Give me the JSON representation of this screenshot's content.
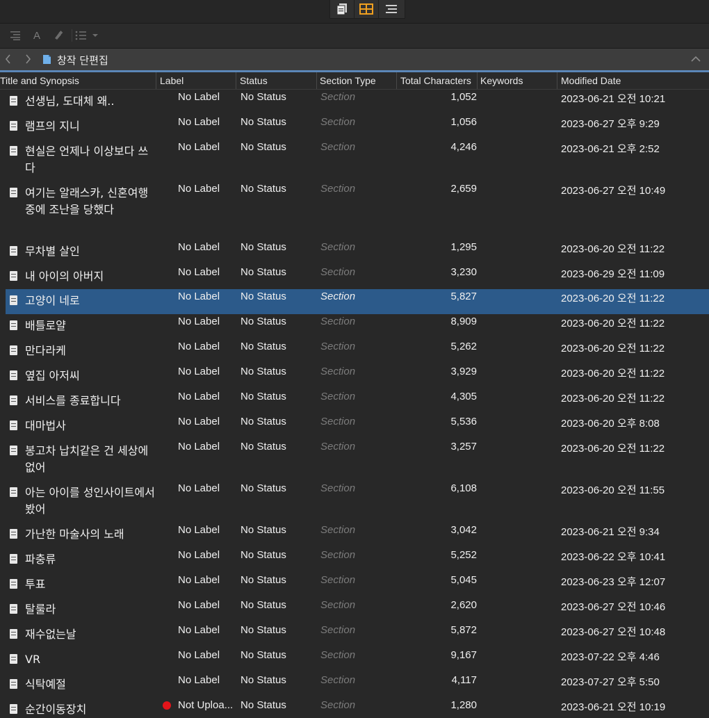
{
  "columns": {
    "title": "Title and Synopsis",
    "label": "Label",
    "status": "Status",
    "section_type": "Section Type",
    "total_characters": "Total Characters",
    "keywords": "Keywords",
    "modified_date": "Modified Date"
  },
  "nav": {
    "folder_title": "창작 단편집"
  },
  "toolbar": {
    "font_label": "A"
  },
  "rows": [
    {
      "title": "선생님, 도대체 왜..",
      "label": "No Label",
      "status": "No Status",
      "section_type": "Section",
      "chars": "1,052",
      "modified": "2023-06-21 오전 10:21"
    },
    {
      "title": "램프의 지니",
      "label": "No Label",
      "status": "No Status",
      "section_type": "Section",
      "chars": "1,056",
      "modified": "2023-06-27 오후 9:29"
    },
    {
      "title": "현실은 언제나 이상보다 쓰다",
      "label": "No Label",
      "status": "No Status",
      "section_type": "Section",
      "chars": "4,246",
      "modified": "2023-06-21 오후 2:52"
    },
    {
      "title": "여기는 알래스카, 신혼여행중에 조난을 당했다",
      "label": "No Label",
      "status": "No Status",
      "section_type": "Section",
      "chars": "2,659",
      "modified": "2023-06-27 오전 10:49"
    },
    {
      "title": "무차별 살인",
      "label": "No Label",
      "status": "No Status",
      "section_type": "Section",
      "chars": "1,295",
      "modified": "2023-06-20 오전 11:22"
    },
    {
      "title": "내 아이의 아버지",
      "label": "No Label",
      "status": "No Status",
      "section_type": "Section",
      "chars": "3,230",
      "modified": "2023-06-29 오전 11:09"
    },
    {
      "title": "고양이 네로",
      "label": "No Label",
      "status": "No Status",
      "section_type": "Section",
      "chars": "5,827",
      "modified": "2023-06-20 오전 11:22",
      "selected": true
    },
    {
      "title": "배틀로얄",
      "label": "No Label",
      "status": "No Status",
      "section_type": "Section",
      "chars": "8,909",
      "modified": "2023-06-20 오전 11:22"
    },
    {
      "title": "만다라케",
      "label": "No Label",
      "status": "No Status",
      "section_type": "Section",
      "chars": "5,262",
      "modified": "2023-06-20 오전 11:22"
    },
    {
      "title": "옆집 아저씨",
      "label": "No Label",
      "status": "No Status",
      "section_type": "Section",
      "chars": "3,929",
      "modified": "2023-06-20 오전 11:22"
    },
    {
      "title": "서비스를 종료합니다",
      "label": "No Label",
      "status": "No Status",
      "section_type": "Section",
      "chars": "4,305",
      "modified": "2023-06-20 오전 11:22"
    },
    {
      "title": "대마법사",
      "label": "No Label",
      "status": "No Status",
      "section_type": "Section",
      "chars": "5,536",
      "modified": "2023-06-20 오후 8:08"
    },
    {
      "title": "봉고차 납치같은 건 세상에 없어",
      "label": "No Label",
      "status": "No Status",
      "section_type": "Section",
      "chars": "3,257",
      "modified": "2023-06-20 오전 11:22"
    },
    {
      "title": "아는 아이를 성인사이트에서 봤어",
      "label": "No Label",
      "status": "No Status",
      "section_type": "Section",
      "chars": "6,108",
      "modified": "2023-06-20 오전 11:55"
    },
    {
      "title": "가난한 마술사의 노래",
      "label": "No Label",
      "status": "No Status",
      "section_type": "Section",
      "chars": "3,042",
      "modified": "2023-06-21 오전 9:34"
    },
    {
      "title": "파충류",
      "label": "No Label",
      "status": "No Status",
      "section_type": "Section",
      "chars": "5,252",
      "modified": "2023-06-22 오후 10:41"
    },
    {
      "title": "투표",
      "label": "No Label",
      "status": "No Status",
      "section_type": "Section",
      "chars": "5,045",
      "modified": "2023-06-23 오후 12:07"
    },
    {
      "title": "탈룰라",
      "label": "No Label",
      "status": "No Status",
      "section_type": "Section",
      "chars": "2,620",
      "modified": "2023-06-27 오전 10:46"
    },
    {
      "title": "재수없는날",
      "label": "No Label",
      "status": "No Status",
      "section_type": "Section",
      "chars": "5,872",
      "modified": "2023-06-27 오전 10:48"
    },
    {
      "title": "VR",
      "label": "No Label",
      "status": "No Status",
      "section_type": "Section",
      "chars": "9,167",
      "modified": "2023-07-22 오후 4:46"
    },
    {
      "title": "식탁예절",
      "label": "No Label",
      "status": "No Status",
      "section_type": "Section",
      "chars": "4,117",
      "modified": "2023-07-27 오후 5:50"
    },
    {
      "title": "순간이동장치",
      "label": "Not Uploa...",
      "status": "No Status",
      "section_type": "Section",
      "chars": "1,280",
      "modified": "2023-06-21 오전 10:19",
      "label_dot": "#e3141a"
    }
  ]
}
